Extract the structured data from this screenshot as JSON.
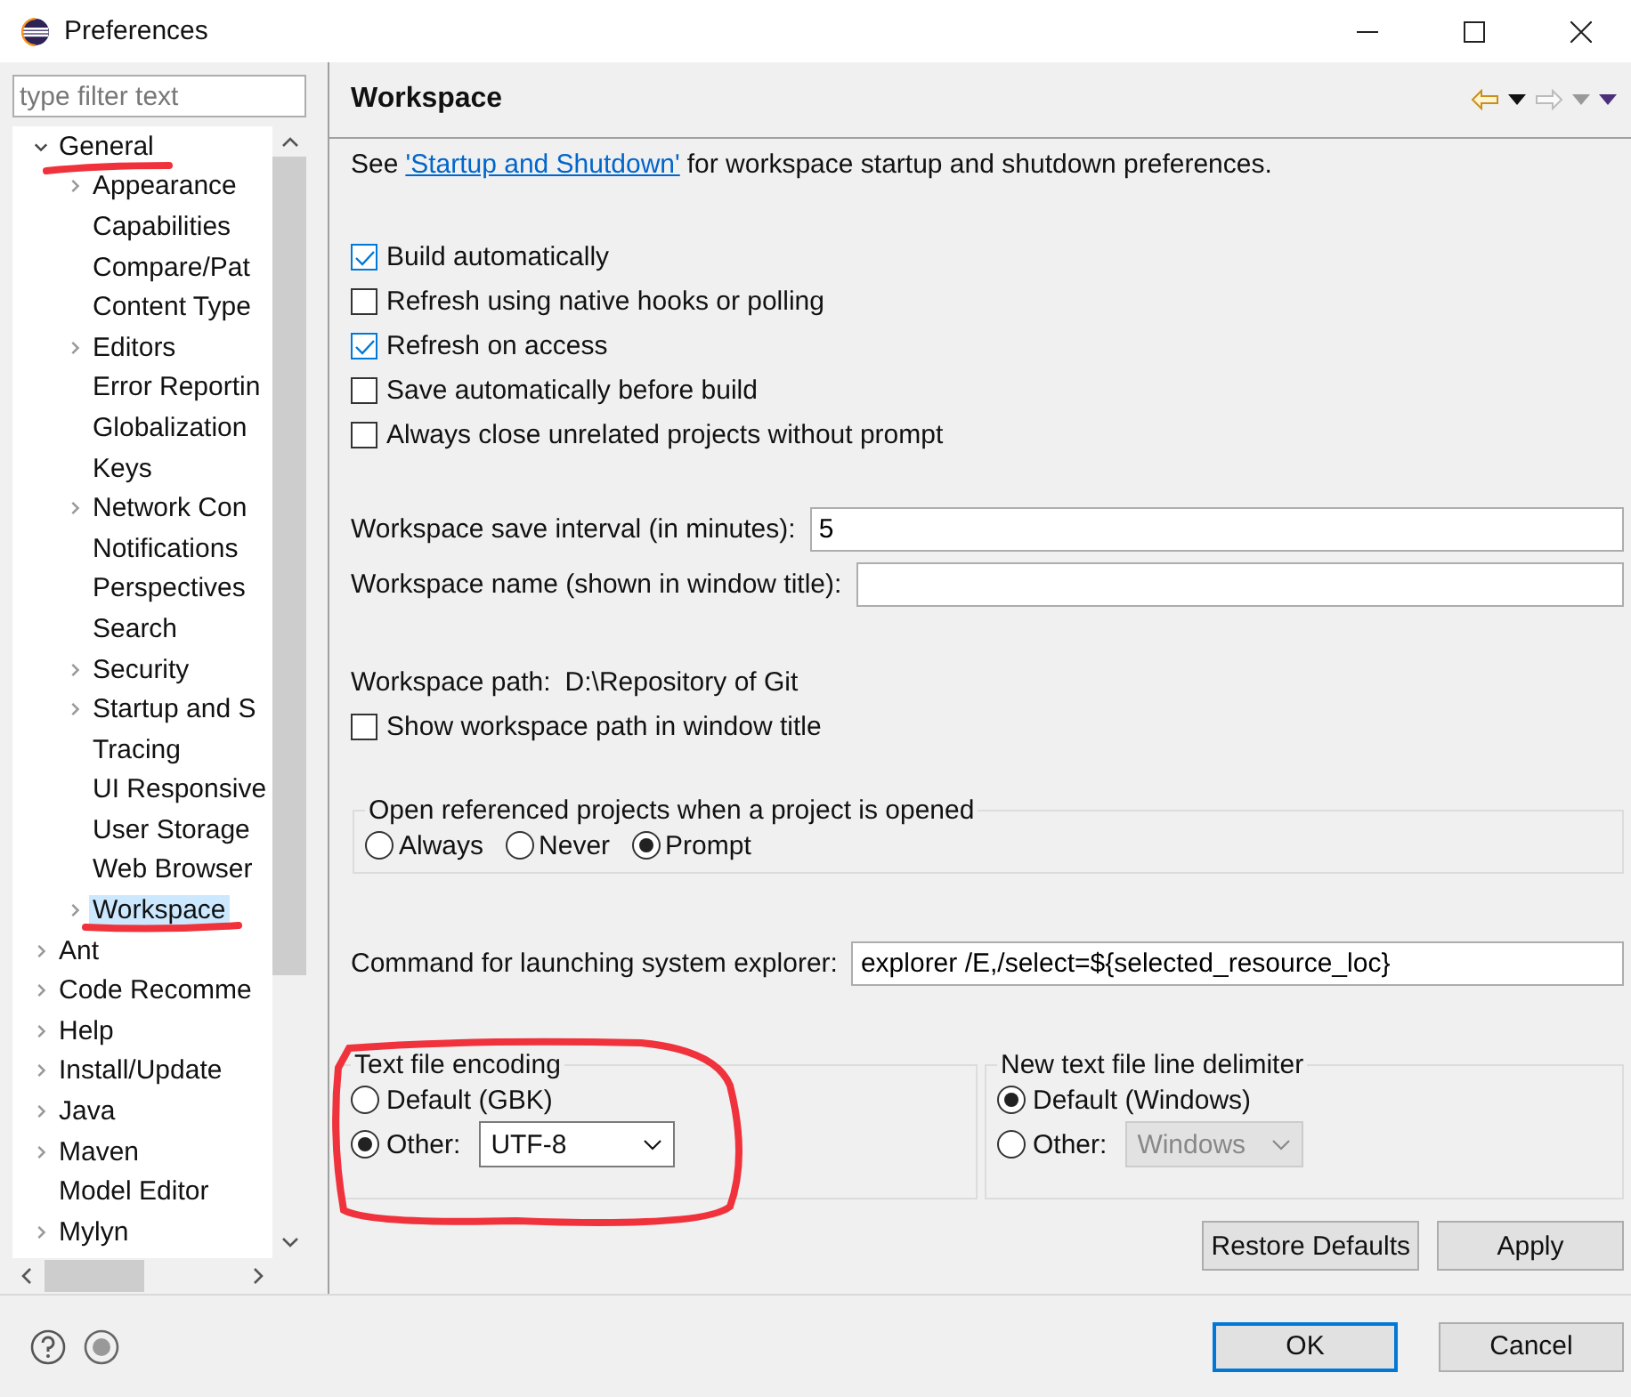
{
  "window": {
    "title": "Preferences"
  },
  "filter": {
    "placeholder": "type filter text"
  },
  "tree": [
    {
      "label": "General",
      "kind": "branch",
      "expanded": true,
      "selected": false,
      "children": [
        {
          "label": "Appearance",
          "kind": "branch",
          "expanded": false,
          "selected": false
        },
        {
          "label": "Capabilities",
          "kind": "leaf",
          "expanded": false,
          "selected": false
        },
        {
          "label": "Compare/Pat",
          "kind": "leaf",
          "expanded": false,
          "selected": false
        },
        {
          "label": "Content Type",
          "kind": "leaf",
          "expanded": false,
          "selected": false
        },
        {
          "label": "Editors",
          "kind": "branch",
          "expanded": false,
          "selected": false
        },
        {
          "label": "Error Reportin",
          "kind": "leaf",
          "expanded": false,
          "selected": false
        },
        {
          "label": "Globalization",
          "kind": "leaf",
          "expanded": false,
          "selected": false
        },
        {
          "label": "Keys",
          "kind": "leaf",
          "expanded": false,
          "selected": false
        },
        {
          "label": "Network Con",
          "kind": "branch",
          "expanded": false,
          "selected": false
        },
        {
          "label": "Notifications",
          "kind": "leaf",
          "expanded": false,
          "selected": false
        },
        {
          "label": "Perspectives",
          "kind": "leaf",
          "expanded": false,
          "selected": false
        },
        {
          "label": "Search",
          "kind": "leaf",
          "expanded": false,
          "selected": false
        },
        {
          "label": "Security",
          "kind": "branch",
          "expanded": false,
          "selected": false
        },
        {
          "label": "Startup and S",
          "kind": "branch",
          "expanded": false,
          "selected": false
        },
        {
          "label": "Tracing",
          "kind": "leaf",
          "expanded": false,
          "selected": false
        },
        {
          "label": "UI Responsive",
          "kind": "leaf",
          "expanded": false,
          "selected": false
        },
        {
          "label": "User Storage",
          "kind": "leaf",
          "expanded": false,
          "selected": false
        },
        {
          "label": "Web Browser",
          "kind": "leaf",
          "expanded": false,
          "selected": false
        },
        {
          "label": "Workspace",
          "kind": "branch",
          "expanded": false,
          "selected": true
        }
      ]
    },
    {
      "label": "Ant",
      "kind": "branch",
      "expanded": false,
      "selected": false
    },
    {
      "label": "Code Recomme",
      "kind": "branch",
      "expanded": false,
      "selected": false
    },
    {
      "label": "Help",
      "kind": "branch",
      "expanded": false,
      "selected": false
    },
    {
      "label": "Install/Update",
      "kind": "branch",
      "expanded": false,
      "selected": false
    },
    {
      "label": "Java",
      "kind": "branch",
      "expanded": false,
      "selected": false
    },
    {
      "label": "Maven",
      "kind": "branch",
      "expanded": false,
      "selected": false
    },
    {
      "label": "Model Editor",
      "kind": "leaf",
      "expanded": false,
      "selected": false
    },
    {
      "label": "Mylyn",
      "kind": "branch",
      "expanded": false,
      "selected": false
    }
  ],
  "page": {
    "title": "Workspace",
    "intro_before": "See",
    "intro_link": "'Startup and Shutdown'",
    "intro_after": "for workspace startup and shutdown preferences.",
    "options": [
      {
        "label": "Build automatically",
        "checked": true
      },
      {
        "label": "Refresh using native hooks or polling",
        "checked": false
      },
      {
        "label": "Refresh on access",
        "checked": true
      },
      {
        "label": "Save automatically before build",
        "checked": false
      },
      {
        "label": "Always close unrelated projects without prompt",
        "checked": false
      }
    ],
    "save_interval": {
      "label": "Workspace save interval (in minutes):",
      "value": "5"
    },
    "workspace_name": {
      "label": "Workspace name (shown in window title):"
    },
    "workspace_path": {
      "label": "Workspace path:",
      "value": "D:\\Repository of Git"
    },
    "show_path": {
      "label": "Show workspace path in window title",
      "checked": false
    },
    "open_referenced": {
      "title": "Open referenced projects when a project is opened",
      "choices": [
        {
          "label": "Always",
          "selected": false
        },
        {
          "label": "Never",
          "selected": false
        },
        {
          "label": "Prompt",
          "selected": true
        }
      ]
    },
    "explorer_command": {
      "label": "Command for launching system explorer:",
      "value": "explorer /E,/select=${selected_resource_loc}"
    },
    "encoding": {
      "title": "Text file encoding",
      "choices": [
        {
          "label": "Default (GBK)",
          "selected": false
        },
        {
          "label": "Other:",
          "selected": true
        }
      ],
      "other_value": "UTF-8",
      "disabled": false
    },
    "line_delimiter": {
      "title": "New text file line delimiter",
      "choices": [
        {
          "label": "Default (Windows)",
          "selected": true
        },
        {
          "label": "Other:",
          "selected": false
        }
      ],
      "other_value": "Windows",
      "disabled": true
    },
    "buttons": [
      "Restore Defaults",
      "Apply"
    ]
  },
  "dialog_buttons": [
    {
      "label": "OK",
      "default": true
    },
    {
      "label": "Cancel",
      "default": false
    }
  ]
}
